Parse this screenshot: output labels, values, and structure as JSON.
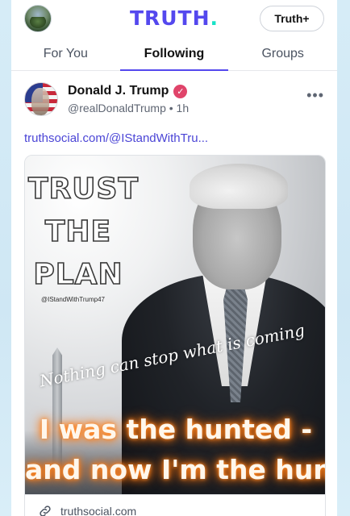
{
  "app": {
    "logo_text": "TRUTH",
    "logo_dot": ".",
    "brand_color": "#5448ee",
    "dot_color": "#17e2c7",
    "truthplus_label": "Truth+"
  },
  "tabs": [
    {
      "label": "For You",
      "active": false
    },
    {
      "label": "Following",
      "active": true
    },
    {
      "label": "Groups",
      "active": false
    }
  ],
  "post": {
    "author_name": "Donald J. Trump",
    "verified_icon": "verified-badge-icon",
    "handle": "@realDonaldTrump",
    "separator": "•",
    "time": "1h",
    "more_icon": "more-options-icon",
    "more_glyph": "•••",
    "link_text": "truthsocial.com/@IStandWithTru...",
    "image": {
      "title_lines": [
        "TRUST",
        "THE",
        "PLAN"
      ],
      "watermark": "@IStandWithTrump47",
      "script_text": "Nothing can stop what is coming",
      "glow_lines": [
        "I was the hunted -",
        "and now I'm the hunter"
      ]
    },
    "card_footer": {
      "icon": "link-icon",
      "domain": "truthsocial.com"
    }
  }
}
